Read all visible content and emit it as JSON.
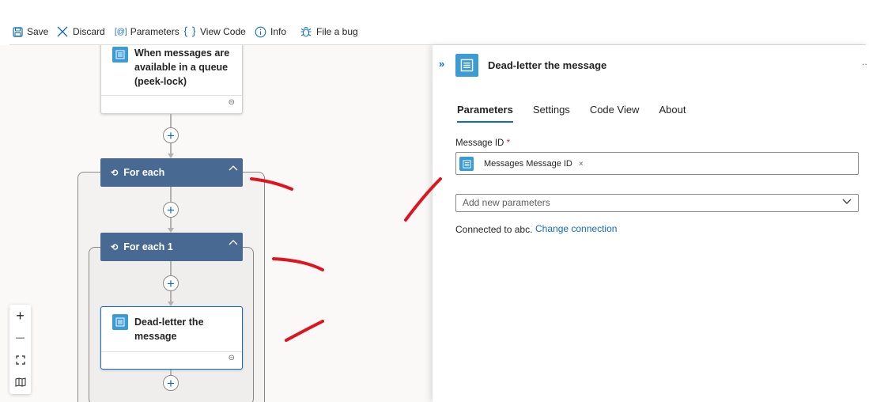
{
  "toolbar": {
    "save": "Save",
    "discard": "Discard",
    "parameters": "Parameters",
    "parameters_icon_text": "[@]",
    "view_code": "View Code",
    "info": "Info",
    "file_bug": "File a bug"
  },
  "canvas": {
    "trigger_title": "When messages are available in a queue (peek-lock)",
    "foreach_title": "For each",
    "foreach1_title": "For each 1",
    "deadletter_title": "Dead-letter the message",
    "plus": "+",
    "link_icon_glyph": "⊝"
  },
  "zoom": {
    "zoom_in": "+",
    "zoom_out": "—"
  },
  "panel": {
    "title": "Dead-letter the message",
    "tabs": [
      "Parameters",
      "Settings",
      "Code View",
      "About"
    ],
    "active_tab": "Parameters",
    "field_label": "Message ID",
    "required_marker": "*",
    "token_text": "Messages Message ID",
    "token_remove": "×",
    "add_params_placeholder": "Add new parameters",
    "connected_text": "Connected to abc.",
    "change_connection": "Change connection",
    "more": ".."
  },
  "colors": {
    "loop_header": "#486991",
    "action_icon": "#3b9bd4",
    "accent": "#0f6cbd",
    "annotation": "#e0141e"
  }
}
